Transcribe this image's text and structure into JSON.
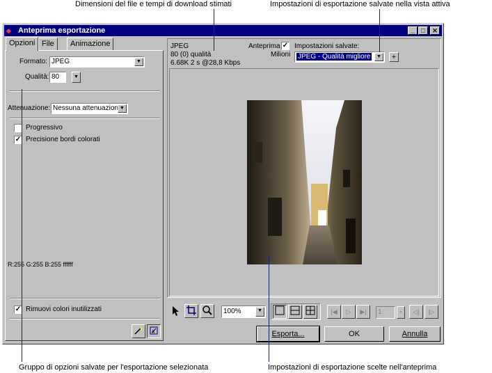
{
  "callouts": {
    "top_left": "Dimensioni del file e tempi di download stimati",
    "top_right": "Impostazioni di esportazione salvate nella vista attiva",
    "bottom_left": "Gruppo di opzioni salvate per l'esportazione selezionata",
    "bottom_right": "Impostazioni di esportazione scelte nell'anteprima"
  },
  "window": {
    "title": "Anteprima esportazione",
    "minimize": "_",
    "maximize": "□",
    "close": "✕"
  },
  "tabs": [
    "Opzioni",
    "File",
    "Animazione"
  ],
  "options": {
    "format_label": "Formato:",
    "format_value": "JPEG",
    "quality_label": "Qualità:",
    "quality_value": "80",
    "smoothing_label": "Attenuazione:",
    "smoothing_value": "Nessuna attenuazion",
    "progressive_label": "Progressivo",
    "progressive_checked": false,
    "sharpen_label": "Precisione bordi colorati",
    "sharpen_checked": true,
    "color_readout": "R:255 G:255 B:255 ffffff",
    "remove_unused_label": "Rimuovi colori inutilizzati",
    "remove_unused_checked": true
  },
  "preview": {
    "format": "JPEG",
    "quality_info": "80 (0) qualità",
    "size_info": "6.68K  2 s @28,8 Kbps",
    "preview_label": "Anteprima",
    "preview_checked": true,
    "colors": "Milioni",
    "saved_settings_label": "Impostazioni salvate:",
    "saved_settings_value": "JPEG - Qualità migliore",
    "add_button": "+"
  },
  "toolbar": {
    "zoom_value": "100%",
    "frame_value": "1"
  },
  "buttons": {
    "export": "Esporta...",
    "ok": "OK",
    "cancel": "Annulla"
  },
  "colors": {
    "title_bar": "#000080",
    "window": "#c0c0c0",
    "callout_line": "#1a1f6e",
    "selection": "#000080"
  }
}
